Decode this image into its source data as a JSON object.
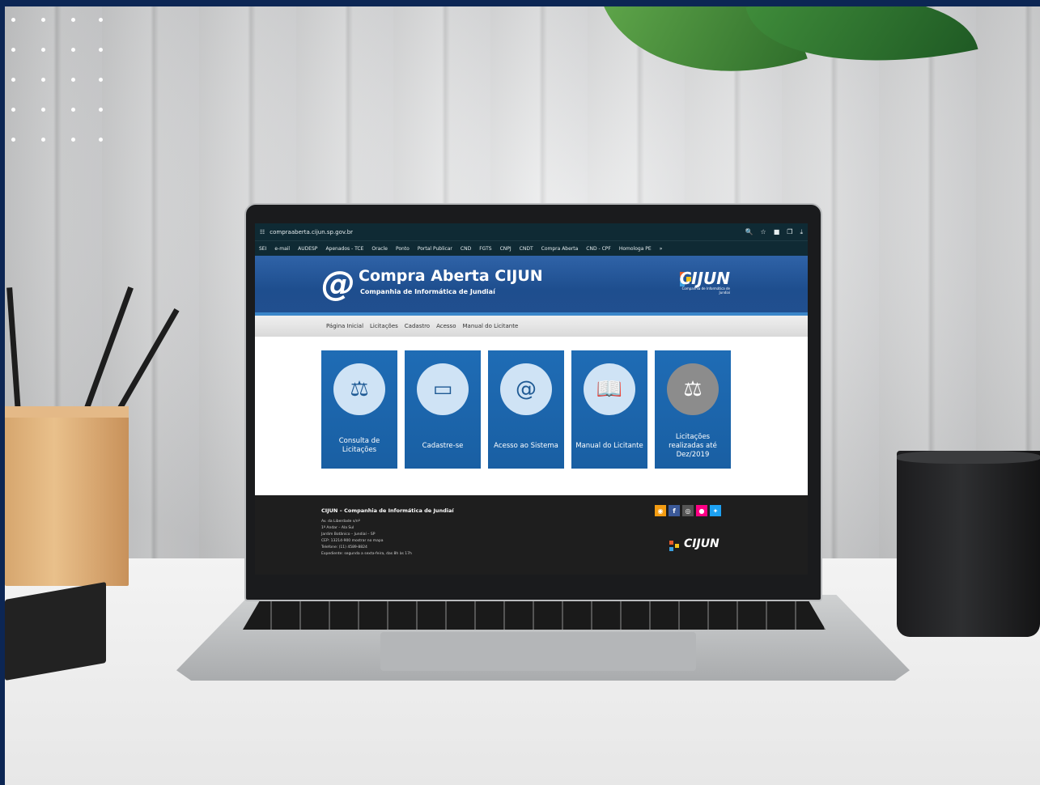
{
  "browser": {
    "url": "compraaberta.cijun.sp.gov.br",
    "bookmarks": [
      "SEI",
      "e-mail",
      "AUDESP",
      "Apenados - TCE",
      "Oracle",
      "Ponto",
      "Portal Publicar",
      "CND",
      "FGTS",
      "CNPJ",
      "CNDT",
      "Compra Aberta",
      "CND - CPF",
      "Homologa PE"
    ],
    "more": "»"
  },
  "header": {
    "at_symbol": "@",
    "title": "Compra Aberta CIJUN",
    "subtitle": "Companhia de Informática de Jundiaí",
    "brand": "CIJUN",
    "brand_small": "Companhia de Informática de Jundiaí"
  },
  "nav": {
    "items": [
      "Página Inicial",
      "Licitações",
      "Cadastro",
      "Acesso",
      "Manual do Licitante"
    ]
  },
  "tiles": [
    {
      "label": "Consulta de Licitações",
      "icon": "gavel-icon",
      "glyph": "⚖"
    },
    {
      "label": "Cadastre-se",
      "icon": "monitor-icon",
      "glyph": "▭"
    },
    {
      "label": "Acesso ao Sistema",
      "icon": "at-icon",
      "glyph": "@"
    },
    {
      "label": "Manual do Licitante",
      "icon": "book-icon",
      "glyph": "📖"
    },
    {
      "label": "Licitações realizadas até Dez/2019",
      "icon": "gavel-icon",
      "glyph": "⚖"
    }
  ],
  "footer": {
    "title": "CIJUN – Companhia de Informática de Jundiaí",
    "lines": [
      "Av. da Liberdade s/nº",
      "1º Andar – Ala Sul",
      "Jardim Botânico – Jundiaí – SP",
      "CEP: 13214-900 mostrar no mapa",
      "Telefone: (11) 4589-8824",
      "Expediente: segunda a sexta-feira, das 8h às 17h"
    ],
    "social": [
      "rss",
      "f",
      "ig",
      "flickr",
      "tw"
    ],
    "brand": "CIJUN"
  },
  "colors": {
    "frame": "#0c2654",
    "header_blue": "#1e4e8e",
    "tile_blue": "#1f6cb5",
    "footer_bg": "#1e1e1e"
  }
}
